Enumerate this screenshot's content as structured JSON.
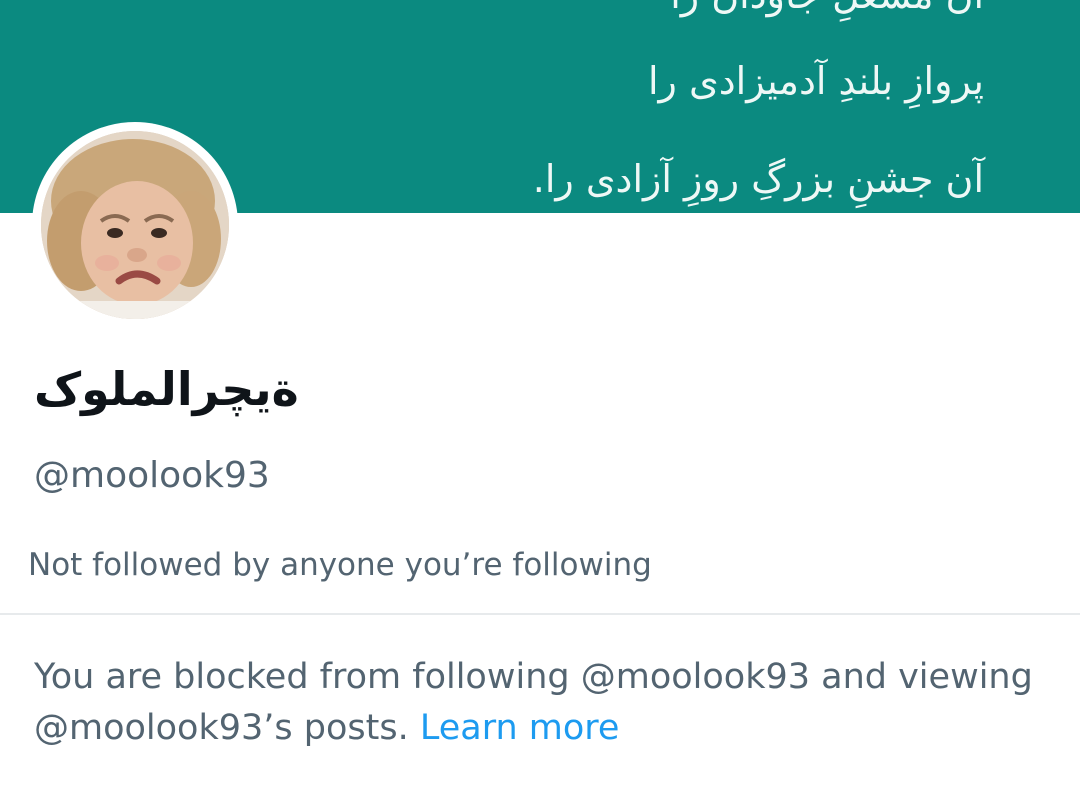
{
  "banner": {
    "background_color": "#0b8a80",
    "lines": [
      "آن مشعلِ جاودان را",
      "پروازِ بلندِ آدمیزادی را",
      "آن جشنِ بزرگِ روزِ آزادی را."
    ]
  },
  "avatar": {
    "icon": "profile-photo-toddler-frowning"
  },
  "profile": {
    "display_name": "ةيچرالملوک",
    "handle": "@moolook93",
    "followed_by": "Not followed by anyone you’re following"
  },
  "notice": {
    "text": "You are blocked from following @moolook93 and viewing @moolook93’s posts. ",
    "link_label": "Learn more",
    "link_color": "#1d9bf0"
  }
}
